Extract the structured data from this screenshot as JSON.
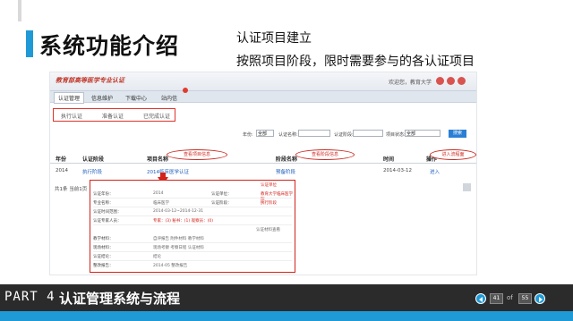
{
  "slide": {
    "title": "系统功能介绍",
    "subtitle_line1": "认证项目建立",
    "subtitle_line2": "按照项目阶段，限时需要参与的各认证项目"
  },
  "screenshot": {
    "logo_text": "教育部高等医学专业认证",
    "welcome_text": "欢迎您，教育大学",
    "nav": [
      {
        "label": "认证管理",
        "active": true
      },
      {
        "label": "信息维护",
        "active": false
      },
      {
        "label": "下载中心",
        "active": false
      },
      {
        "label": "站内信",
        "active": false
      }
    ],
    "subtabs": [
      "执行认证",
      "准备认证",
      "已完成认证"
    ],
    "filters": [
      {
        "label": "年份:",
        "value": "全部"
      },
      {
        "label": "认证名称:",
        "value": ""
      },
      {
        "label": "认证阶段:",
        "value": ""
      },
      {
        "label": "项目状态:",
        "value": "全部"
      }
    ],
    "search_button": "搜索",
    "table": {
      "headers": [
        "年份",
        "认证阶段",
        "项目名称",
        "阶段名称",
        "时间",
        "操作"
      ],
      "row": [
        "2014",
        "执行阶段",
        "2014临床医学认证",
        "预备阶段",
        "2014-03-12",
        "进入"
      ]
    },
    "pager": "共1条 当前1页",
    "bubbles": {
      "view_project": "查看项目信息",
      "view_stage": "查看阶段信息",
      "enter_flow": "进入流程面"
    },
    "popup": {
      "header": "认证单位",
      "rows": [
        {
          "label": "认证年份：",
          "value": "2014",
          "label2": "认证单位：",
          "value2": "教育大学临床医学院",
          "red": true
        },
        {
          "label": "专业名称：",
          "value": "临床医学",
          "label2": "认证阶段：",
          "value2": "执行阶段",
          "red": true
        },
        {
          "label": "认证时间范围：",
          "value": "2014-03-12~2014-12-31",
          "label2": "",
          "value2": "",
          "red": false
        },
        {
          "label": "认证专家人员：",
          "value": "专家：(3)  秘书：(1)  观察员：(0)",
          "label2": "",
          "value2": "",
          "red": true
        },
        {
          "label": "教学材料：",
          "value": "自评报告  附件材料  教学材料",
          "label2": "",
          "value2": "",
          "red": false
        },
        {
          "label": "现场材料：",
          "value": "现场考察  考察日程  认证材料",
          "label2": "",
          "value2": "",
          "red": false
        },
        {
          "label": "认证结论：",
          "value": "结论",
          "label2": "",
          "value2": "",
          "red": false
        },
        {
          "label": "整改报告：",
          "value": "2014-05  整改报告",
          "label2": "",
          "value2": "",
          "red": false
        }
      ],
      "right_note": "认证材料查看"
    }
  },
  "footer": {
    "part": "PART 4",
    "title": "认证管理系统与流程",
    "current_page": "41",
    "of": "of",
    "total_pages": "55"
  }
}
